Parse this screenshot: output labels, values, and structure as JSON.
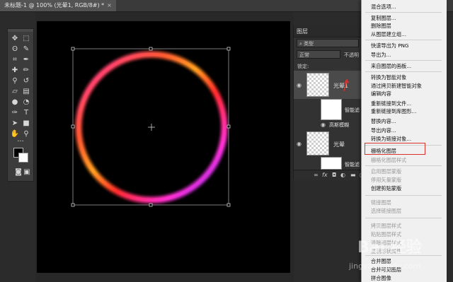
{
  "document_tab": {
    "title": "未标题-1 @ 100% (光晕1, RGB/8#) *",
    "close": "×"
  },
  "toolbar": {
    "tools": [
      "move-icon",
      "marquee-icon",
      "lasso-icon",
      "quick-select-icon",
      "crop-icon",
      "eyedropper-icon",
      "healing-icon",
      "brush-icon",
      "stamp-icon",
      "history-brush-icon",
      "eraser-icon",
      "gradient-icon",
      "blur-icon",
      "dodge-icon",
      "pen-icon",
      "type-icon",
      "path-select-icon",
      "shape-icon",
      "hand-icon",
      "zoom-icon"
    ],
    "more": "···"
  },
  "layers_panel": {
    "tab": "图层",
    "filter": "类型",
    "blend_mode": "正常",
    "opacity_label": "不透明",
    "lock_label": "锁定:",
    "layers": [
      {
        "name": "光晕1",
        "selected": true
      },
      {
        "name": "智能滤",
        "sub": true
      },
      {
        "name": "高斯模糊",
        "sub": true
      },
      {
        "name": "光晕",
        "selected": false
      },
      {
        "name": "智能滤",
        "sub": true
      }
    ],
    "footer_icons": [
      "link-icon",
      "fx-icon",
      "mask-icon",
      "adjustment-icon",
      "folder-icon",
      "new-layer-icon",
      "trash-icon"
    ]
  },
  "context_menu": {
    "items": [
      {
        "label": "混合选项...",
        "disabled": false
      },
      {
        "label": "复制图层...",
        "disabled": false
      },
      {
        "label": "删除图层",
        "disabled": false
      },
      {
        "label": "从图层建立组...",
        "disabled": false
      },
      {
        "label": "快速导出为 PNG",
        "disabled": false
      },
      {
        "label": "导出为...",
        "disabled": false
      },
      {
        "label": "来自图层的画板...",
        "disabled": false
      },
      {
        "label": "转换为智能对象",
        "disabled": false
      },
      {
        "label": "通过拷贝新建智能对象",
        "disabled": false
      },
      {
        "label": "编辑内容",
        "disabled": false
      },
      {
        "label": "重新链接到文件...",
        "disabled": false
      },
      {
        "label": "重新链接到库图形...",
        "disabled": false
      },
      {
        "label": "替换内容...",
        "disabled": false
      },
      {
        "label": "导出内容...",
        "disabled": false
      },
      {
        "label": "转换为链接对象...",
        "disabled": false
      },
      {
        "label": "栅格化图层",
        "disabled": false,
        "highlighted": true
      },
      {
        "label": "栅格化图层样式",
        "disabled": true
      },
      {
        "label": "启用图层蒙版",
        "disabled": true
      },
      {
        "label": "停用矢量蒙版",
        "disabled": true
      },
      {
        "label": "创建剪贴蒙版",
        "disabled": false
      },
      {
        "label": "链接图层",
        "disabled": true
      },
      {
        "label": "选择链接图层",
        "disabled": true
      },
      {
        "label": "拷贝图层样式",
        "disabled": true
      },
      {
        "label": "粘贴图层样式",
        "disabled": true
      },
      {
        "label": "清除图层样式",
        "disabled": true
      },
      {
        "label": "复制形状属性",
        "disabled": true
      },
      {
        "label": "合并图层",
        "disabled": false
      },
      {
        "label": "合并可见图层",
        "disabled": false
      },
      {
        "label": "拼合图像",
        "disabled": false
      }
    ]
  },
  "watermark": {
    "text": "Bai 经验",
    "sub": "jingyan.baidu.com"
  },
  "colors": {
    "accent_red": "#d9312b",
    "canvas": "#000000"
  }
}
